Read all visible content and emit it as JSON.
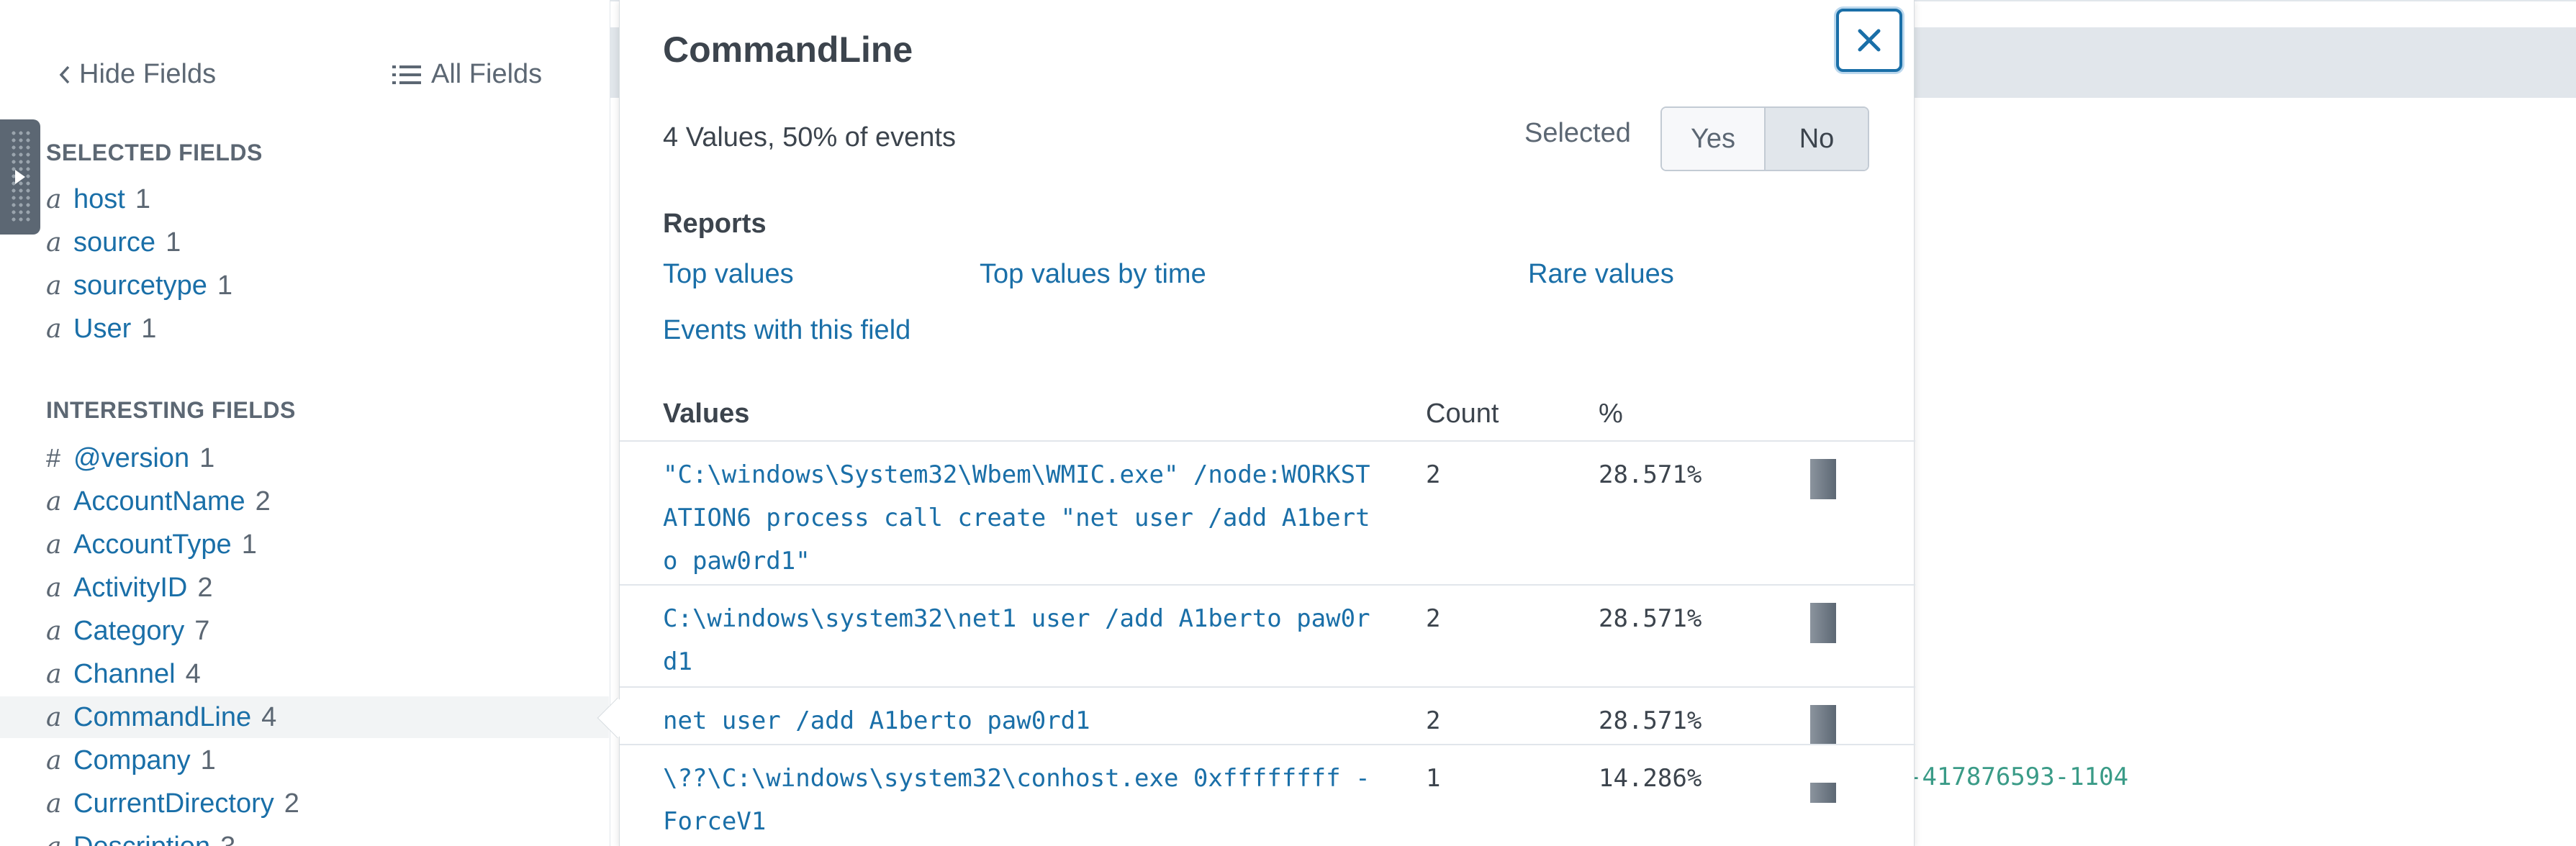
{
  "sidebar": {
    "hide_fields_label": "Hide Fields",
    "all_fields_label": "All Fields",
    "selected_fields_heading": "SELECTED FIELDS",
    "interesting_fields_heading": "INTERESTING FIELDS",
    "selected_fields": [
      {
        "type": "a",
        "name": "host",
        "count": "1"
      },
      {
        "type": "a",
        "name": "source",
        "count": "1"
      },
      {
        "type": "a",
        "name": "sourcetype",
        "count": "1"
      },
      {
        "type": "a",
        "name": "User",
        "count": "1"
      }
    ],
    "interesting_fields": [
      {
        "type": "#",
        "name": "@version",
        "count": "1"
      },
      {
        "type": "a",
        "name": "AccountName",
        "count": "2"
      },
      {
        "type": "a",
        "name": "AccountType",
        "count": "1"
      },
      {
        "type": "a",
        "name": "ActivityID",
        "count": "2"
      },
      {
        "type": "a",
        "name": "Category",
        "count": "7"
      },
      {
        "type": "a",
        "name": "Channel",
        "count": "4"
      },
      {
        "type": "a",
        "name": "CommandLine",
        "count": "4"
      },
      {
        "type": "a",
        "name": "Company",
        "count": "1"
      },
      {
        "type": "a",
        "name": "CurrentDirectory",
        "count": "2"
      },
      {
        "type": "a",
        "name": "Description",
        "count": "3"
      }
    ]
  },
  "popover": {
    "title": "CommandLine",
    "summary": "4 Values, 50% of events",
    "selected_label": "Selected",
    "toggle": {
      "yes": "Yes",
      "no": "No",
      "active": "No"
    },
    "reports_heading": "Reports",
    "reports": {
      "top_values": "Top values",
      "top_values_by_time": "Top values by time",
      "rare_values": "Rare values",
      "events_with_field": "Events with this field"
    },
    "columns": {
      "values": "Values",
      "count": "Count",
      "percent": "%"
    },
    "values": [
      {
        "value": "\"C:\\windows\\System32\\Wbem\\WMIC.exe\" /node:WORKSTATION6 process call create \"net user /add A1berto paw0rd1\"",
        "count": "2",
        "percent": "28.571%",
        "fraction": 0.28571
      },
      {
        "value": "C:\\windows\\system32\\net1 user /add A1berto paw0rd1",
        "count": "2",
        "percent": "28.571%",
        "fraction": 0.28571
      },
      {
        "value": "net user /add A1berto paw0rd1",
        "count": "2",
        "percent": "28.571%",
        "fraction": 0.28571
      },
      {
        "value": "\\??\\C:\\windows\\system32\\conhost.exe 0xffffffff -ForceV1",
        "count": "1",
        "percent": "14.286%",
        "fraction": 0.14286
      }
    ]
  },
  "background": {
    "event_fragment": "-417876593-1104"
  },
  "colors": {
    "link": "#1a6fa8",
    "text": "#3c444d",
    "muted": "#5c6773",
    "focus": "#1a6fa8",
    "fragment": "#3a9b87"
  },
  "icons": {
    "hide_fields": "chevron-left-icon",
    "all_fields": "list-icon",
    "close": "close-icon",
    "drag": "drag-handle-icon"
  }
}
